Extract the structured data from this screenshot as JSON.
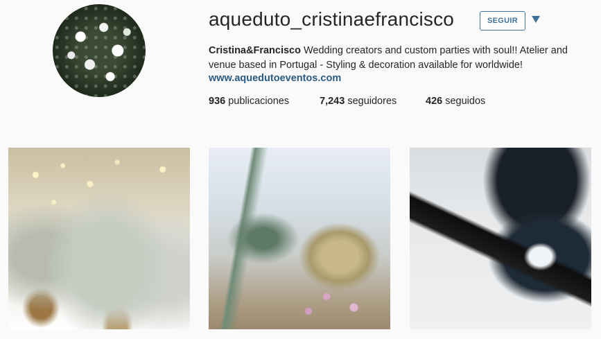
{
  "profile": {
    "username": "aqueduto_cristinaefrancisco",
    "follow_label": "SEGUIR",
    "bio_name": "Cristina&Francisco",
    "bio_text": " Wedding creators and custom parties with soul!! Atelier and venue based in Portugal - Styling & decoration available for worldwide!",
    "website": "www.aquedutoeventos.com"
  },
  "stats": {
    "posts_count": "936",
    "posts_label": "publicaciones",
    "followers_count": "7,243",
    "followers_label": "seguidores",
    "following_count": "426",
    "following_label": "seguidos"
  },
  "colors": {
    "accent": "#3f729b",
    "link": "#2b5a83",
    "background": "#fafafa"
  },
  "icons": {
    "dropdown": "chevron-down-icon"
  }
}
